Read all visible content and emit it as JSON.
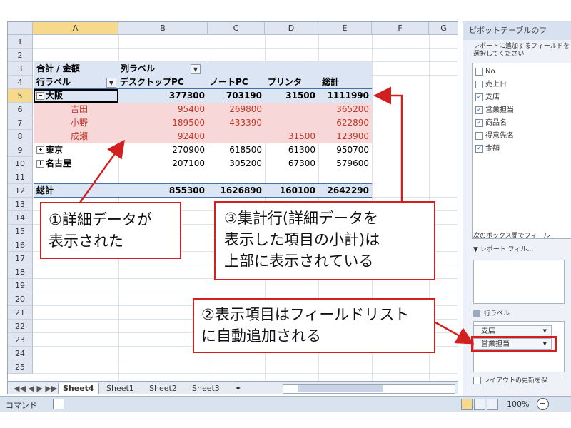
{
  "grid": {
    "columns": [
      "A",
      "B",
      "C",
      "D",
      "E",
      "F",
      "G"
    ],
    "rows": [
      "1",
      "2",
      "3",
      "4",
      "5",
      "6",
      "7",
      "8",
      "9",
      "10",
      "11",
      "12",
      "13",
      "14",
      "15",
      "16",
      "17",
      "18",
      "19",
      "20",
      "21",
      "22",
      "23",
      "24",
      "25"
    ],
    "pivot": {
      "r3_a": "合計 / 金額",
      "r3_b": "列ラベル",
      "r4_a": "行ラベル",
      "r4_b": "デスクトップPC",
      "r4_c": "ノートPC",
      "r4_d": "プリンタ",
      "r4_e": "総計",
      "r5": [
        "大阪",
        "377300",
        "703190",
        "31500",
        "1111990"
      ],
      "r6": [
        "吉田",
        "95400",
        "269800",
        "",
        "365200"
      ],
      "r7": [
        "小野",
        "189500",
        "433390",
        "",
        "622890"
      ],
      "r8": [
        "成瀬",
        "92400",
        "",
        "31500",
        "123900"
      ],
      "r9": [
        "東京",
        "270900",
        "618500",
        "61300",
        "950700"
      ],
      "r10": [
        "名古屋",
        "207100",
        "305200",
        "67300",
        "579600"
      ],
      "r11": [
        "総計",
        "855300",
        "1626890",
        "160100",
        "2642290"
      ]
    }
  },
  "sheet_tabs": [
    "Sheet4",
    "Sheet1",
    "Sheet2",
    "Sheet3"
  ],
  "status": {
    "mode": "コマンド",
    "zoom": "100%"
  },
  "pane": {
    "title": "ピボットテーブルのフ",
    "instruction": "レポートに追加するフィールドを選択してください",
    "fields": [
      {
        "label": "No",
        "checked": false
      },
      {
        "label": "売上日",
        "checked": false
      },
      {
        "label": "支店",
        "checked": true
      },
      {
        "label": "営業担当",
        "checked": true
      },
      {
        "label": "商品名",
        "checked": true
      },
      {
        "label": "得意先名",
        "checked": false
      },
      {
        "label": "金額",
        "checked": true
      }
    ],
    "areas_label": "次のボックス間でフィール",
    "report_filter": "レポート フィル...",
    "row_labels": "行ラベル",
    "row_items": [
      "支店",
      "営業担当"
    ],
    "defer_update": "レイアウトの更新を保"
  },
  "callouts": {
    "c1": "①詳細データが\n表示された",
    "c2": "②表示項目はフィールドリスト\nに自動追加される",
    "c3": "③集計行(詳細データを\n表示した項目の小計)は\n上部に表示されている"
  }
}
